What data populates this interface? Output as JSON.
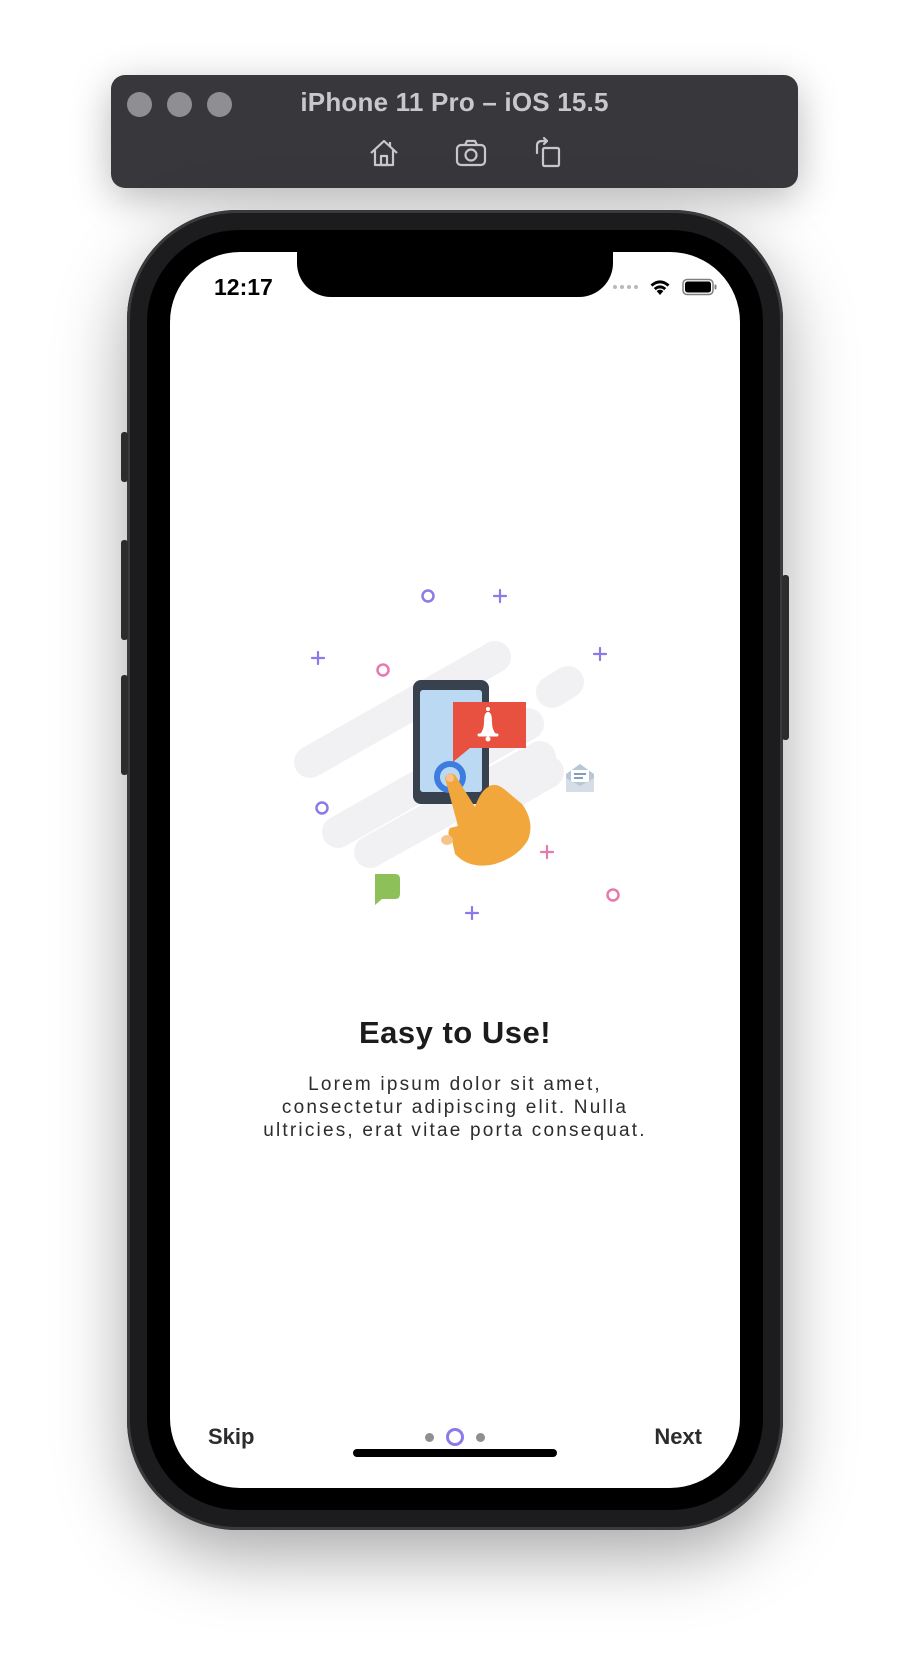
{
  "simulator": {
    "title": "iPhone 11 Pro – iOS 15.5",
    "tools": [
      {
        "icon": "home-icon"
      },
      {
        "icon": "camera-icon"
      },
      {
        "icon": "rotate-icon"
      }
    ]
  },
  "status_bar": {
    "time": "12:17",
    "icons": [
      "signal-icon",
      "wifi-icon",
      "battery-icon"
    ]
  },
  "onboarding": {
    "illustration": "phone-notification-illustration",
    "title": "Easy to Use!",
    "description": "Lorem ipsum dolor sit amet, consectetur adipiscing elit. Nulla ultricies, erat vitae porta consequat.",
    "skip_label": "Skip",
    "next_label": "Next",
    "page_count": 3,
    "current_page": 2
  },
  "colors": {
    "accent": "#8b7ae8",
    "bell_card": "#e8513f",
    "hand": "#f2a73d",
    "chat_bubble": "#8ec05a",
    "sparkle_pink": "#e878b0",
    "phone_body": "#37424e",
    "phone_screen": "#bcd9f3"
  }
}
